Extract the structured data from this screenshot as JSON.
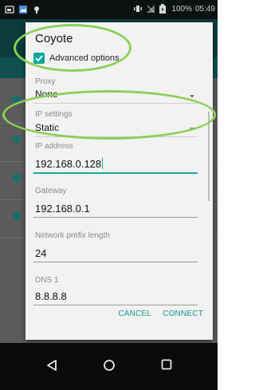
{
  "status_bar": {
    "battery_percent": "100%",
    "time": "05:49"
  },
  "dialog": {
    "title": "Coyote",
    "advanced_options": {
      "label": "Advanced options",
      "checked": true
    },
    "proxy": {
      "label": "Proxy",
      "value": "None"
    },
    "ip_settings": {
      "label": "IP settings",
      "value": "Static"
    },
    "ip_address": {
      "label": "IP address",
      "value": "192.168.0.128"
    },
    "gateway": {
      "label": "Gateway",
      "value": "192.168.0.1"
    },
    "prefix_length": {
      "label": "Network prefix length",
      "value": "24"
    },
    "dns1": {
      "label": "DNS 1",
      "value": "8.8.8.8"
    },
    "cancel_label": "CANCEL",
    "connect_label": "CONNECT"
  },
  "colors": {
    "accent": "#10a89c",
    "annotation": "#8ccf5a",
    "status_bar": "#0e1112"
  },
  "icons": {
    "nav_back": "back-triangle-icon",
    "nav_home": "home-circle-icon",
    "nav_recents": "recents-square-icon"
  }
}
